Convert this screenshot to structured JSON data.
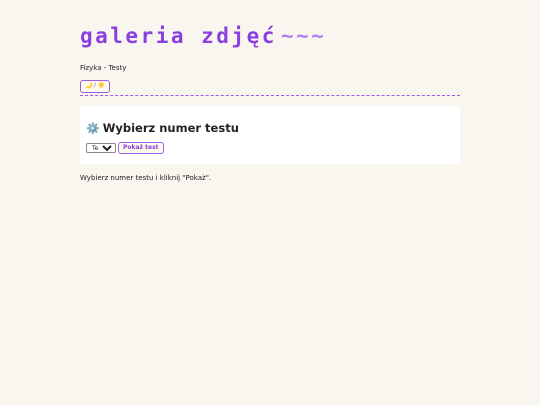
{
  "header": {
    "title": "galeria zdjęć",
    "title_suffix": "~~~",
    "breadcrumb": "Fizyka - Testy"
  },
  "theme_toggle": {
    "label": "🌙 / ☀️"
  },
  "panel": {
    "icon": "gear-icon",
    "icon_glyph": "⚙️",
    "title": "Wybierz numer testu",
    "select": {
      "selected": "Test 1",
      "options": [
        "Test 1"
      ]
    },
    "show_button_label": "Pokaż test"
  },
  "hint_text": "Wybierz numer testu i kliknij \"Pokaż\".",
  "colors": {
    "accent": "#8a3fe0",
    "background": "#f9f6f0",
    "panel_background": "#ffffff",
    "button_background": "#fffbea"
  }
}
